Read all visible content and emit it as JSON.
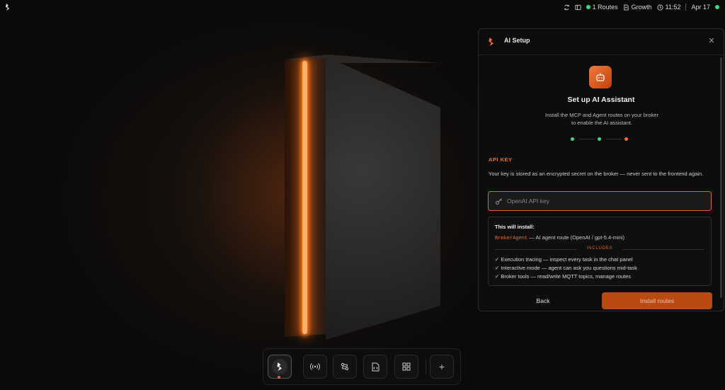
{
  "topbar": {
    "routes_label": "1 Routes",
    "workspace_label": "Growth",
    "time": "11:52",
    "date": "Apr 17",
    "status_color": "#3ddc84"
  },
  "panel": {
    "title": "AI Setup",
    "heading": "Set up AI Assistant",
    "subtitle_line1": "Install the MCP and Agent routes on your broker",
    "subtitle_line2": "to enable the AI assistant.",
    "steps": [
      {
        "state": "done",
        "color": "#3ddc84"
      },
      {
        "state": "done",
        "color": "#3ddc84"
      },
      {
        "state": "current",
        "color": "#f0732a"
      }
    ],
    "api_key_section_label": "API KEY",
    "api_key_description": "Your key is stored as an encrypted secret on the broker — never sent to the frontend again.",
    "api_key_input": {
      "placeholder": "OpenAI API key",
      "value": ""
    },
    "install_box": {
      "title": "This will install:",
      "agent_name": "BrokerAgent",
      "agent_description": " — AI agent route (OpenAI / gpt-5.4-mini)",
      "includes_label": "INCLUDES",
      "features": [
        "✓ Execution tracing — inspect every task in the chat panel",
        "✓ Interactive mode — agent can ask you questions mid-task",
        "✓ Broker tools — read/write MQTT topics, manage routes"
      ]
    },
    "back_label": "Back",
    "install_label": "Install routes"
  },
  "dock": {
    "items": [
      {
        "name": "home",
        "icon": "logo-icon",
        "active": true
      },
      {
        "name": "broadcast",
        "icon": "broadcast-icon",
        "active": false
      },
      {
        "name": "routes",
        "icon": "routes-icon",
        "active": false
      },
      {
        "name": "code",
        "icon": "code-file-icon",
        "active": false
      },
      {
        "name": "dashboard",
        "icon": "grid-icon",
        "active": false
      },
      {
        "name": "add",
        "icon": "plus-icon",
        "active": false
      }
    ]
  },
  "colors": {
    "accent": "#f0732a",
    "success": "#3ddc84"
  }
}
